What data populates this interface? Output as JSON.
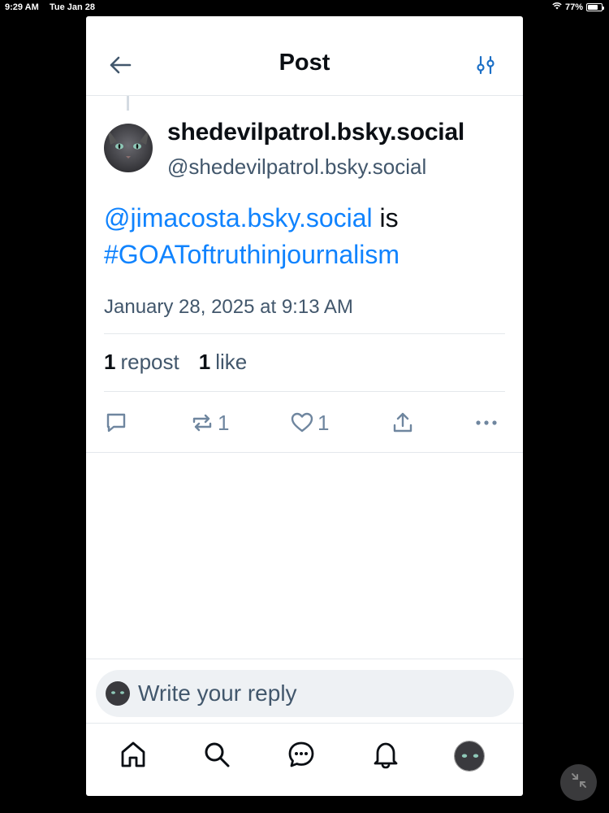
{
  "status_bar": {
    "time": "9:29 AM",
    "date": "Tue Jan 28",
    "battery": "77%",
    "battery_level": 0.77,
    "wifi_icon": "wifi-icon"
  },
  "header": {
    "title": "Post",
    "back_icon": "back-arrow-icon",
    "settings_icon": "sliders-icon"
  },
  "post": {
    "display_name": "shedevilpatrol.bsky.social",
    "handle": "@shedevilpatrol.bsky.social",
    "text": {
      "mention": "@jimacosta.bsky.social",
      "middle": " is",
      "hashtag": "#GOAToftruthinjournalism"
    },
    "timestamp": "January 28, 2025 at 9:13 AM",
    "stats": {
      "reposts_count": "1",
      "reposts_label": "repost",
      "likes_count": "1",
      "likes_label": "like"
    },
    "actions": {
      "reply_icon": "reply-icon",
      "repost_icon": "repost-icon",
      "repost_count": "1",
      "like_icon": "heart-icon",
      "like_count": "1",
      "share_icon": "share-icon",
      "more_icon": "more-icon"
    }
  },
  "reply": {
    "placeholder": "Write your reply"
  },
  "tabbar": {
    "items": [
      "home-icon",
      "search-icon",
      "chat-icon",
      "bell-icon",
      "profile-avatar"
    ]
  },
  "colors": {
    "link": "#1083fe",
    "muted": "#42576c",
    "icon": "#6f869f",
    "text": "#0b0f14"
  }
}
